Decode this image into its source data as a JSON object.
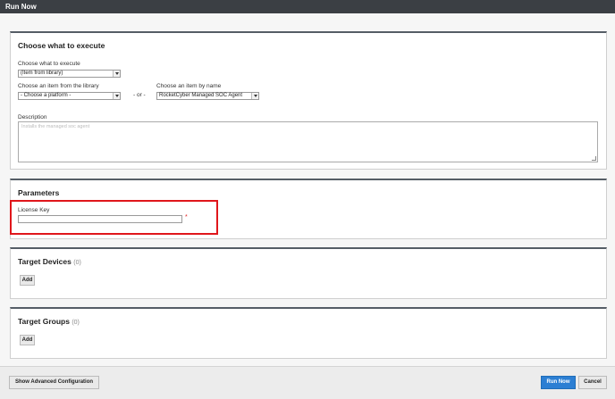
{
  "window": {
    "title": "Run Now"
  },
  "execute": {
    "heading": "Choose what to execute",
    "choose_label": "Choose what to execute",
    "choose_value": "(Item from library)",
    "library_label": "Choose an item from the library",
    "platform_value": "- Choose a platform -",
    "or_text": "- or -",
    "byname_label": "Choose an item by name",
    "byname_value": "RocketCyber Managed SOC Agent",
    "description_label": "Description",
    "description_value": "Installs the managed soc agent"
  },
  "parameters": {
    "heading": "Parameters",
    "license_label": "License Key",
    "license_value": "",
    "required_mark": "*",
    "highlight_color": "#e0161b"
  },
  "target_devices": {
    "heading": "Target Devices",
    "count": "(0)",
    "add_label": "Add"
  },
  "target_groups": {
    "heading": "Target Groups",
    "count": "(0)",
    "add_label": "Add"
  },
  "footer": {
    "advanced_label": "Show Advanced Configuration",
    "run_label": "Run Now",
    "cancel_label": "Cancel",
    "accent_color": "#2c7fd3"
  }
}
